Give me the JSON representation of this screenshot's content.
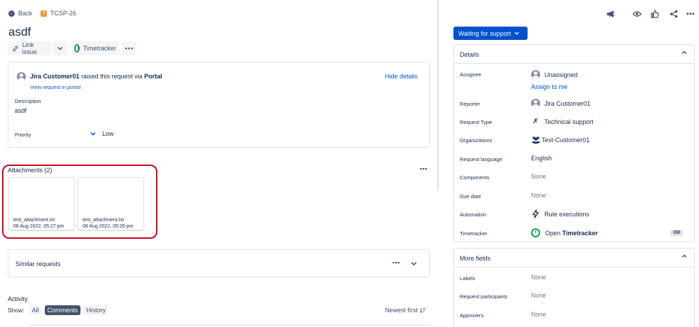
{
  "nav": {
    "back_label": "Back",
    "issue_key": "TCSP-26"
  },
  "issue": {
    "title": "asdf"
  },
  "toolbar": {
    "link_issue_label": "Link issue",
    "timetracker_label": "Timetracker"
  },
  "request": {
    "customer_name": "Jira Customer01",
    "raised_text": "raised this request via",
    "channel": "Portal",
    "view_in_portal": "View request in portal",
    "hide_details": "Hide details",
    "description_label": "Description",
    "description_value": "asdf",
    "priority_label": "Priority",
    "priority_value": "Low"
  },
  "attachments": {
    "heading": "Attachments (2)",
    "items": [
      {
        "name": "test_attachment.txt",
        "date": "08 Aug 2022, 05:27 pm"
      },
      {
        "name": "test_attachment.txt",
        "date": "08 Aug 2022, 05:26 pm"
      }
    ]
  },
  "similar": {
    "heading": "Similar requests"
  },
  "activity": {
    "heading": "Activity",
    "show_label": "Show:",
    "tabs": [
      "All",
      "Comments",
      "History"
    ],
    "active_tab": "Comments",
    "sort_label": "Newest first"
  },
  "status": {
    "label": "Waiting for support"
  },
  "details": {
    "heading": "Details",
    "assignee_label": "Assignee",
    "assignee_value": "Unassigned",
    "assign_to_me": "Assign to me",
    "reporter_label": "Reporter",
    "reporter_value": "Jira Customer01",
    "request_type_label": "Request Type",
    "request_type_value": "Technical support",
    "organizations_label": "Organizations",
    "organizations_value": "Test-Customer01",
    "language_label": "Request language",
    "language_value": "English",
    "components_label": "Components",
    "components_value": "None",
    "due_date_label": "Due date",
    "due_date_value": "None",
    "automation_label": "Automation",
    "automation_value": "Rule executions",
    "timetracker_label": "Timetracker",
    "timetracker_open": "Open",
    "timetracker_name": "Timetracker",
    "timetracker_badge": "0M"
  },
  "more_fields": {
    "heading": "More fields",
    "labels_label": "Labels",
    "labels_value": "None",
    "participants_label": "Request participants",
    "participants_value": "None",
    "approvers_label": "Approvers",
    "approvers_value": "None"
  },
  "colors": {
    "accent": "#0052cc",
    "highlight": "#d0021b",
    "timetracker_green": "#1e9a4b"
  }
}
